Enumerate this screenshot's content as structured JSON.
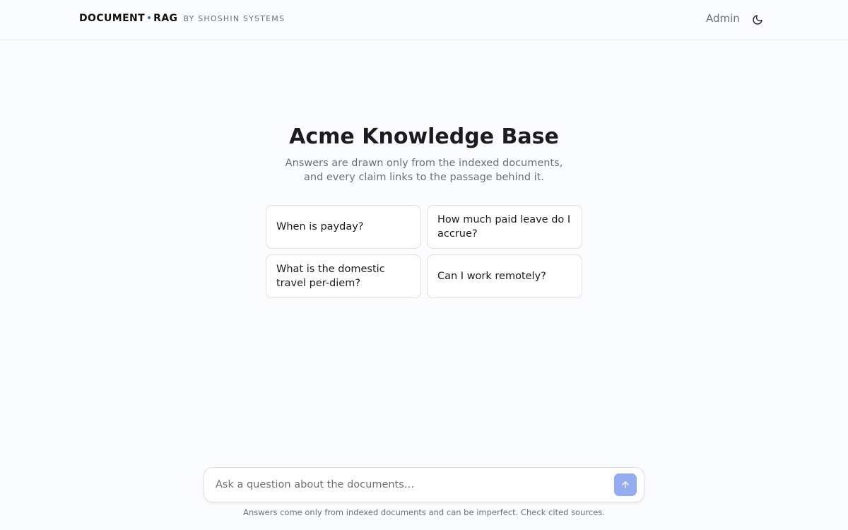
{
  "header": {
    "brand_left": "DOCUMENT",
    "brand_right": "RAG",
    "brand_byline": "BY SHOSHIN SYSTEMS",
    "admin_label": "Admin",
    "theme_icon": "moon-icon",
    "accent_color": "#3b5fd8"
  },
  "hero": {
    "title": "Acme Knowledge Base",
    "subtitle_line1": "Answers are drawn only from the indexed documents,",
    "subtitle_line2": "and every claim links to the passage behind it."
  },
  "suggestions": [
    {
      "label": "When is payday?"
    },
    {
      "label": "How much paid leave do I accrue?"
    },
    {
      "label": "What is the domestic travel per-diem?"
    },
    {
      "label": "Can I work remotely?"
    }
  ],
  "composer": {
    "placeholder": "Ask a question about the documents…",
    "value": "",
    "send_icon": "arrow-up-icon",
    "send_color": "#93adf0"
  },
  "footer": {
    "disclaimer": "Answers come only from indexed documents and can be imperfect. Check cited sources."
  }
}
